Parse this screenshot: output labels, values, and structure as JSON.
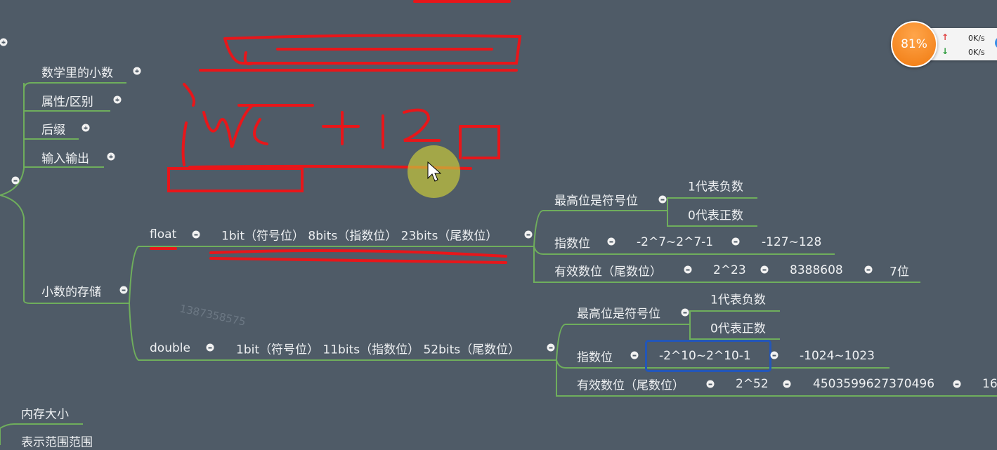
{
  "mindmap": {
    "top": [
      "数学里的小数",
      "属性/区别",
      "后缀",
      "输入输出"
    ],
    "storage": "小数的存储",
    "float": {
      "label": "float",
      "layout": "1bit（符号位） 8bits（指数位） 23bits（尾数位）",
      "sign": "最高位是符号位",
      "neg": "1代表负数",
      "pos": "0代表正数",
      "exp": "指数位",
      "exp_range": "-2^7~2^7-1",
      "exp_val": "-127~128",
      "mant": "有效数位（尾数位）",
      "mant_pow": "2^23",
      "mant_val": "8388608",
      "digits": "7位"
    },
    "double": {
      "label": "double",
      "layout": "1bit（符号位） 11bits（指数位） 52bits（尾数位）",
      "sign": "最高位是符号位",
      "neg": "1代表负数",
      "pos": "0代表正数",
      "exp": "指数位",
      "exp_range": "-2^10~2^10-1",
      "exp_val": "-1024~1023",
      "mant": "有效数位（尾数位）",
      "mant_pow": "2^52",
      "mant_val": "4503599627370496",
      "digits": "16"
    },
    "bottom": [
      "内存大小",
      "表示范围范围"
    ]
  },
  "watermark": "1387358575",
  "speed_widget": {
    "percent": "81%",
    "up": "0K/s",
    "down": "0K/s"
  }
}
